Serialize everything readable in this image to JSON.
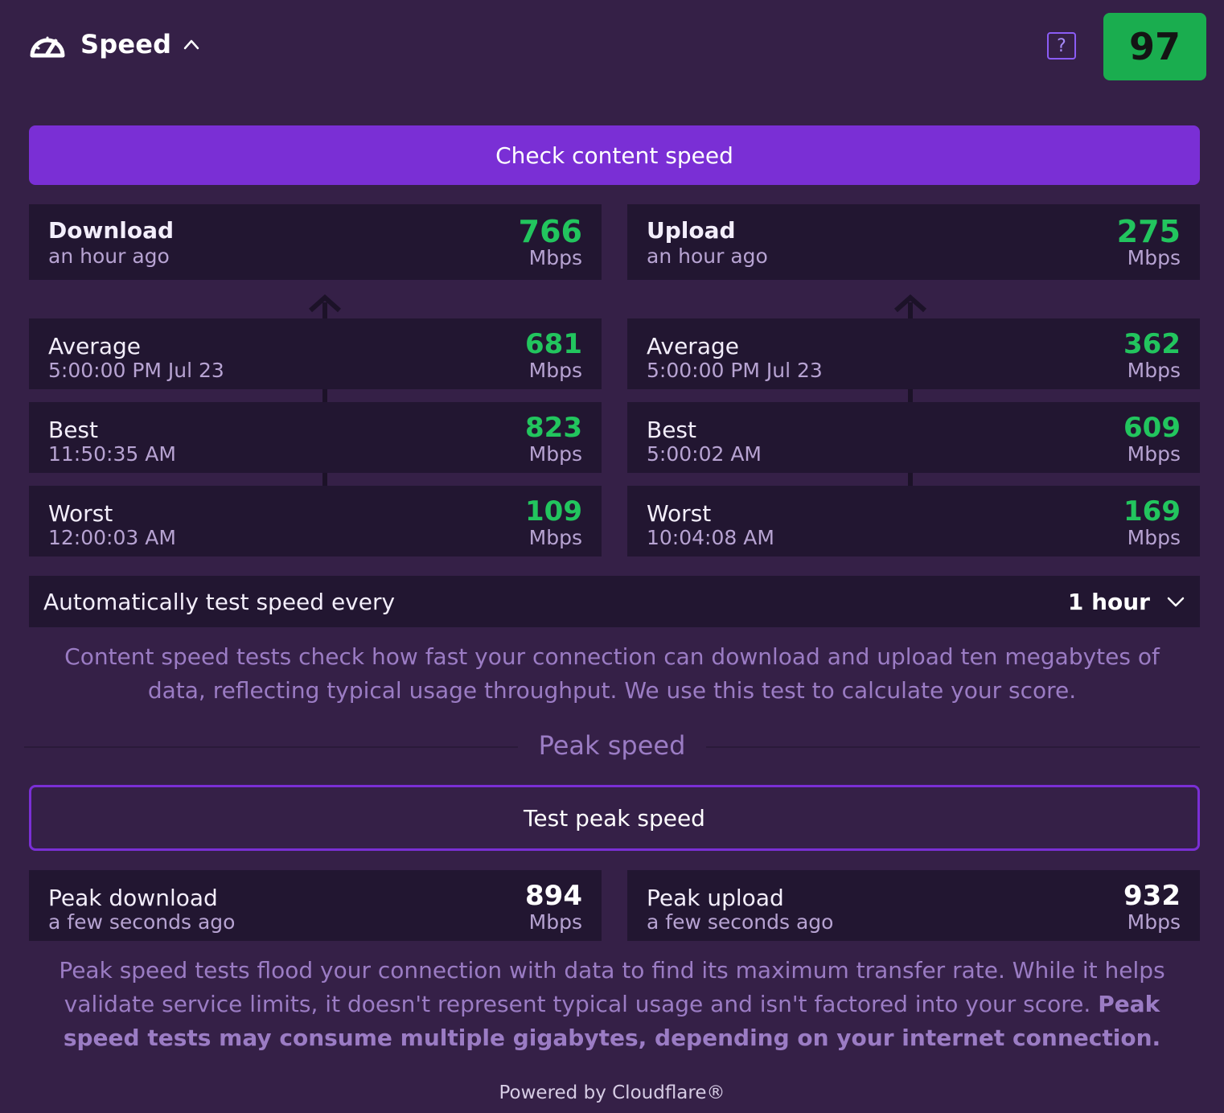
{
  "header": {
    "title": "Speed",
    "help_label": "?",
    "score": "97"
  },
  "check_button": "Check content speed",
  "download": {
    "title": "Download",
    "time": "an hour ago",
    "value": "766",
    "unit": "Mbps",
    "average": {
      "label": "Average",
      "time": "5:00:00 PM Jul 23",
      "value": "681",
      "unit": "Mbps"
    },
    "best": {
      "label": "Best",
      "time": "11:50:35 AM",
      "value": "823",
      "unit": "Mbps"
    },
    "worst": {
      "label": "Worst",
      "time": "12:00:03 AM",
      "value": "109",
      "unit": "Mbps"
    }
  },
  "upload": {
    "title": "Upload",
    "time": "an hour ago",
    "value": "275",
    "unit": "Mbps",
    "average": {
      "label": "Average",
      "time": "5:00:00 PM Jul 23",
      "value": "362",
      "unit": "Mbps"
    },
    "best": {
      "label": "Best",
      "time": "5:00:02 AM",
      "value": "609",
      "unit": "Mbps"
    },
    "worst": {
      "label": "Worst",
      "time": "10:04:08 AM",
      "value": "169",
      "unit": "Mbps"
    }
  },
  "auto_test": {
    "label": "Automatically test speed every",
    "value": "1 hour"
  },
  "content_desc": "Content speed tests check how fast your connection can download and upload ten megabytes of data, reflecting typical usage throughput. We use this test to calculate your score.",
  "peak_heading": "Peak speed",
  "peak_button": "Test peak speed",
  "peak_download": {
    "label": "Peak download",
    "time": "a few seconds ago",
    "value": "894",
    "unit": "Mbps"
  },
  "peak_upload": {
    "label": "Peak upload",
    "time": "a few seconds ago",
    "value": "932",
    "unit": "Mbps"
  },
  "peak_desc": "Peak speed tests flood your connection with data to find its maximum transfer rate. While it helps validate service limits, it doesn't represent typical usage and isn't factored into your score.",
  "peak_desc_bold": "Peak speed tests may consume multiple gigabytes, depending on your internet connection.",
  "footer": "Powered by Cloudflare®",
  "colors": {
    "accent": "#7a2fd5",
    "score_bg": "#1aad4f",
    "value_green": "#22c55e",
    "background": "#352047",
    "card_bg": "#221631"
  }
}
